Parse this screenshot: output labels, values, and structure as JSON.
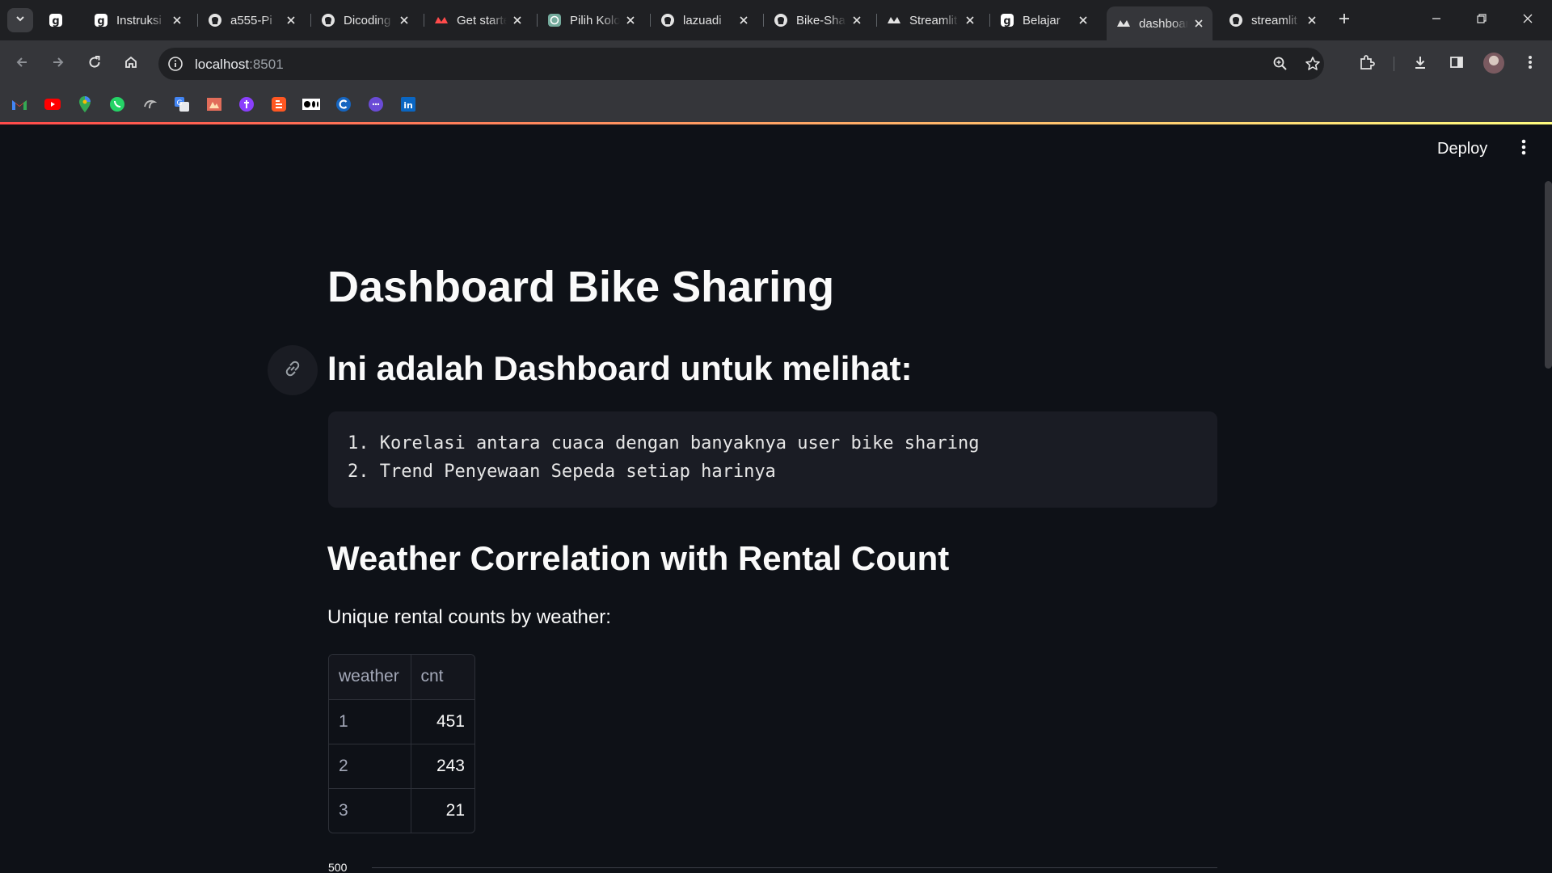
{
  "browser": {
    "tabs": [
      {
        "title": "",
        "icon": "gitbook-icon",
        "active": false
      },
      {
        "title": "Instruksi",
        "icon": "gitbook-icon",
        "active": false
      },
      {
        "title": "a555-Pi",
        "icon": "github-icon",
        "active": false
      },
      {
        "title": "Dicoding",
        "icon": "github-icon",
        "active": false
      },
      {
        "title": "Get started",
        "icon": "streamlit-icon",
        "active": false
      },
      {
        "title": "Pilih Kolom",
        "icon": "chatgpt-icon",
        "active": false
      },
      {
        "title": "lazuadi",
        "icon": "github-icon",
        "active": false
      },
      {
        "title": "Bike-Sharing",
        "icon": "github-icon",
        "active": false
      },
      {
        "title": "Streamlit",
        "icon": "streamlit-icon",
        "active": false
      },
      {
        "title": "Belajar",
        "icon": "gitbook-icon",
        "active": false
      },
      {
        "title": "dashboard",
        "icon": "streamlit-icon",
        "active": true
      },
      {
        "title": "streamlit",
        "icon": "github-icon",
        "active": false
      }
    ],
    "url_host": "localhost",
    "url_port": ":8501",
    "bookmarks": [
      "gmail-icon",
      "youtube-icon",
      "maps-icon",
      "whatsapp-icon",
      "bookmark-icon",
      "translate-icon",
      "bookmark-icon",
      "bookmark-icon",
      "blogger-icon",
      "medium-icon",
      "canva-icon",
      "bookmark-icon",
      "linkedin-icon"
    ]
  },
  "app": {
    "deploy_label": "Deploy",
    "title": "Dashboard Bike Sharing",
    "subheader": "Ini adalah Dashboard untuk melihat:",
    "code_lines": [
      "1. Korelasi antara cuaca dengan banyaknya user bike sharing",
      "2. Trend Penyewaan Sepeda setiap harinya"
    ],
    "section_header": "Weather Correlation with Rental Count",
    "caption": "Unique rental counts by weather:",
    "table": {
      "columns": [
        "weather",
        "cnt"
      ],
      "rows": [
        {
          "index": "1",
          "cnt": "451"
        },
        {
          "index": "2",
          "cnt": "243"
        },
        {
          "index": "3",
          "cnt": "21"
        }
      ]
    },
    "chart_peek_tick": "500"
  },
  "colors": {
    "background": "#0e1117",
    "text": "#fafafa",
    "code_background": "#1a1c24",
    "decoration_start": "#ff4b4b",
    "decoration_end": "#fffd80"
  }
}
